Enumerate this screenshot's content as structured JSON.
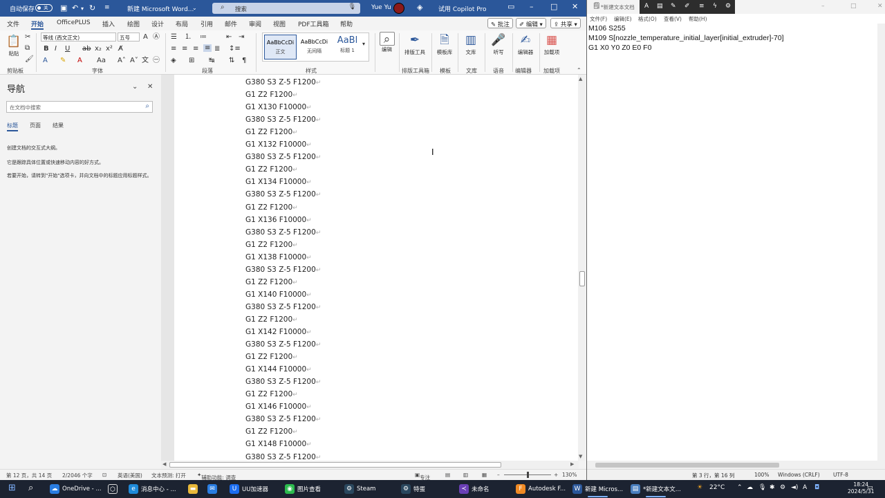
{
  "word": {
    "title_bar": {
      "autosave_label": "自动保存",
      "autosave_state": "关",
      "doc_title": "新建 Microsoft Word...",
      "search_placeholder": "搜索",
      "user_name": "Yue Yu",
      "copilot_label": "试用 Copilot Pro"
    },
    "tabs": [
      "文件",
      "开始",
      "OfficePLUS",
      "插入",
      "绘图",
      "设计",
      "布局",
      "引用",
      "邮件",
      "审阅",
      "视图",
      "PDF工具箱",
      "帮助"
    ],
    "active_tab": "开始",
    "ribbon_actions": {
      "comment": "批注",
      "edit": "编辑",
      "share": "共享"
    },
    "ribbon": {
      "paste": "粘贴",
      "font_name": "等线 (西文正文)",
      "font_size": "五号",
      "styles": [
        {
          "preview": "AaBbCcDi",
          "name": "正文"
        },
        {
          "preview": "AaBbCcDi",
          "name": "无间隔"
        },
        {
          "preview": "AaBl",
          "name": "标题 1"
        }
      ],
      "big_buttons": {
        "edit": "编辑",
        "layout_tool": "排版工具",
        "template": "模板库",
        "docs": "文库",
        "listen": "听写",
        "editor": "编辑器",
        "addin": "加载项"
      },
      "groups": [
        "剪贴板",
        "字体",
        "段落",
        "样式",
        "排版工具箱",
        "模板",
        "文库",
        "语音",
        "编辑器",
        "加载项"
      ]
    },
    "nav": {
      "title": "导航",
      "search_placeholder": "在文档中搜索",
      "tabs": [
        "标题",
        "页面",
        "结果"
      ],
      "active_tab": "标题",
      "messages": [
        "创建文档的交互式大纲。",
        "它是跟踪具体位置或快速移动内容的好方式。",
        "若要开始，请转到\"开始\"选项卡，并向文档中的标题应用标题样式。"
      ]
    },
    "document_lines": [
      "G380 S3 Z-5 F1200",
      "G1 Z2 F1200",
      "G1 X130 F10000",
      "G380 S3 Z-5 F1200",
      "G1 Z2 F1200",
      "G1 X132 F10000",
      "G380 S3 Z-5 F1200",
      "G1 Z2 F1200",
      "G1 X134 F10000",
      "G380 S3 Z-5 F1200",
      "G1 Z2 F1200",
      "G1 X136 F10000",
      "G380 S3 Z-5 F1200",
      "G1 Z2 F1200",
      "G1 X138 F10000",
      "G380 S3 Z-5 F1200",
      "G1 Z2 F1200",
      "G1 X140 F10000",
      "G380 S3 Z-5 F1200",
      "G1 Z2 F1200",
      "G1 X142 F10000",
      "G380 S3 Z-5 F1200",
      "G1 Z2 F1200",
      "G1 X144 F10000",
      "G380 S3 Z-5 F1200",
      "G1 Z2 F1200",
      "G1 X146 F10000",
      "G380 S3 Z-5 F1200",
      "G1 Z2 F1200",
      "G1 X148 F10000",
      "G380 S3 Z-5 F1200"
    ],
    "status": {
      "page": "第 12 页，共 14 页",
      "words": "2/2046 个字",
      "language": "英语(美国)",
      "predict": "文本预测: 打开",
      "accessibility": "辅助功能: 调查",
      "focus": "专注",
      "zoom": "130%"
    }
  },
  "notepad": {
    "title": "*新建文本文档",
    "menu": [
      "文件(F)",
      "编辑(E)",
      "格式(O)",
      "查看(V)",
      "帮助(H)"
    ],
    "lines": [
      "M106 S255",
      "M109 S[nozzle_temperature_initial_layer[initial_extruder]-70]",
      "G1 X0 Y0 Z0 E0 F0"
    ],
    "status": {
      "position": "第 3 行，第 16 列",
      "zoom": "100%",
      "eol": "Windows (CRLF)",
      "encoding": "UTF-8"
    }
  },
  "taskbar": {
    "apps": [
      {
        "label": "OneDrive - ...",
        "icon": "cloud-icon",
        "color": "#2a7de1"
      },
      {
        "label": "",
        "icon": "cube-icon",
        "color": ""
      },
      {
        "label": "消息中心 - ...",
        "icon": "edge-icon",
        "color": "#1f8ad9"
      },
      {
        "label": "",
        "icon": "folder-icon",
        "color": "#e8b83a"
      },
      {
        "label": "",
        "icon": "mail-icon",
        "color": "#2a7de1"
      },
      {
        "label": "UU加速器",
        "icon": "uu-icon",
        "color": "#1a6cf0"
      },
      {
        "label": "图片查看",
        "icon": "wechat-icon",
        "color": "#2dbb4e"
      },
      {
        "label": "Steam",
        "icon": "steam-icon",
        "color": "#2a475e"
      },
      {
        "label": "特蛋",
        "icon": "steam-icon",
        "color": "#2a475e"
      },
      {
        "label": "未命名",
        "icon": "vscode-icon",
        "color": "#6a3fb5"
      },
      {
        "label": "Autodesk F...",
        "icon": "fusion-icon",
        "color": "#f08a24"
      },
      {
        "label": "新建 Micros...",
        "icon": "word-icon",
        "color": "#2b579a"
      },
      {
        "label": "*新建文本文...",
        "icon": "notepad-icon",
        "color": "#4a7fbf"
      }
    ],
    "weather": "22°C",
    "ime": "A",
    "time": "18:24",
    "date": "2024/5/31"
  }
}
